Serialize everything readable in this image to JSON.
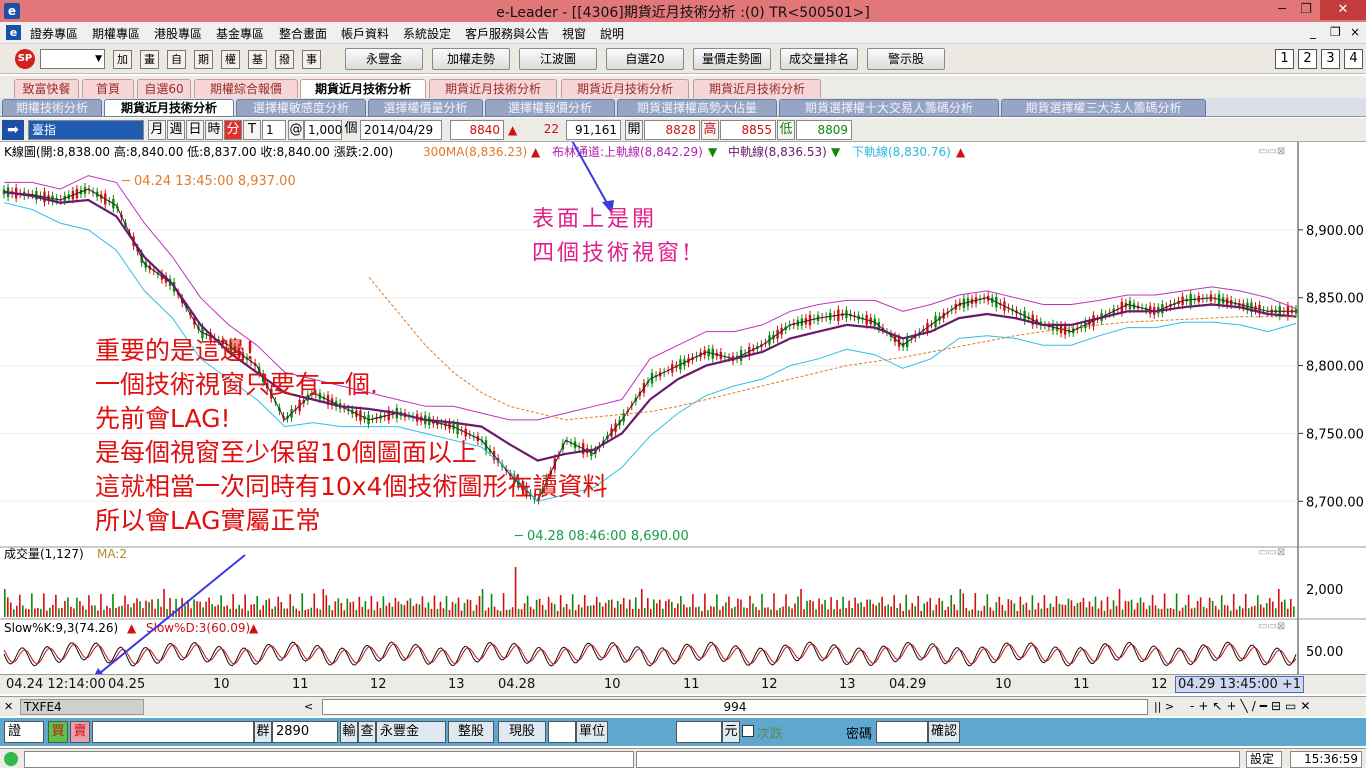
{
  "window": {
    "title": "e-Leader - [[4306]期貨近月技術分析 :(0) TR<500501>]",
    "icon": "e",
    "min": "─",
    "restore": "❐",
    "close": "✕"
  },
  "menu": {
    "icon": "e",
    "items": [
      "證券專區",
      "期權專區",
      "港股專區",
      "基金專區",
      "整合畫面",
      "帳戶資料",
      "系統設定",
      "客戶服務與公告",
      "視窗",
      "說明"
    ],
    "mdi": [
      "_",
      "❐",
      "×"
    ]
  },
  "toolbar": {
    "logo": "SP",
    "small_buttons": [
      "加",
      "畫",
      "自",
      "期",
      "權",
      "基",
      "撥",
      "事"
    ],
    "buttons": [
      "永豐金",
      "加權走勢",
      "江波圖",
      "自選20",
      "量價走勢圖",
      "成交量排名",
      "警示股"
    ],
    "nums": [
      "1",
      "2",
      "3",
      "4"
    ]
  },
  "tabs1": [
    "致富快餐",
    "首頁",
    "自選60",
    "期權綜合報價",
    "期貨近月技術分析",
    "期貨近月技術分析",
    "期貨近月技術分析",
    "期貨近月技術分析"
  ],
  "tabs2": [
    "期權技術分析",
    "期貨近月技術分析",
    "選擇權敏感度分析",
    "選擇權價量分析",
    "選擇權報價分析",
    "期貨選擇權高勢大佔量",
    "期貨選擇權十大交易人籌碼分析",
    "期貨選擇權三大法人籌碼分析"
  ],
  "charttb": {
    "symbol": "臺指",
    "period": [
      "月",
      "週",
      "日",
      "時",
      "分"
    ],
    "t": "T",
    "interval": "1",
    "at": "@",
    "count": "1,000",
    "unit": "個",
    "date": "2014/04/29",
    "price": "8840",
    "change": "22",
    "volume": "91,161",
    "open_label": "開",
    "open": "8828",
    "high_label": "高",
    "high": "8855",
    "low_label": "低",
    "low": "8809"
  },
  "chart": {
    "kline_info": "K線圖(開:8,838.00 高:8,840.00 低:8,837.00 收:8,840.00 漲跌:2.00)",
    "ma300": "300MA(8,836.23)",
    "boll_label": "布林通道:",
    "boll_upper": "上軌線(8,842.29)",
    "boll_mid": "中軌線(8,836.53)",
    "boll_lower": "下軌線(8,830.76)",
    "high_mark": "─ 04.24 13:45:00  8,937.00",
    "low_mark": "─ 04.28 08:46:00  8,690.00",
    "vol_label": "成交量(1,127)",
    "vol_ma": "MA:2",
    "kd_k": "Slow%K:9,3(74.26)",
    "kd_d": "Slow%D:3(60.09)"
  },
  "chart_data": {
    "type": "line",
    "ylim": [
      8670,
      8950
    ],
    "yticks": [
      "8,900.00",
      "8,850.00",
      "8,800.00",
      "8,750.00",
      "8,700.00"
    ],
    "vol_ticks": [
      "2,000"
    ],
    "kd_ticks": [
      "50.00"
    ],
    "xlabels": [
      "04.24 12:14:00",
      "04.25",
      "10",
      "11",
      "12",
      "13",
      "04.28",
      "10",
      "11",
      "12",
      "13",
      "04.29",
      "10",
      "11",
      "12",
      "04.29 13:45:00 +1"
    ],
    "series": [
      {
        "values": [
          8928,
          8926,
          8922,
          8930,
          8918,
          8875,
          8860,
          8825,
          8815,
          8800,
          8760,
          8780,
          8770,
          8760,
          8765,
          8760,
          8755,
          8745,
          8720,
          8700,
          8745,
          8735,
          8760,
          8790,
          8800,
          8810,
          8805,
          8815,
          8830,
          8835,
          8838,
          8832,
          8815,
          8830,
          8845,
          8850,
          8840,
          8830,
          8825,
          8835,
          8845,
          8840,
          8848,
          8850,
          8845,
          8840,
          8840
        ]
      },
      {
        "name": "上軌線",
        "values": [
          8935,
          8935,
          8930,
          8940,
          8935,
          8905,
          8880,
          8850,
          8830,
          8815,
          8795,
          8790,
          8785,
          8780,
          8775,
          8770,
          8770,
          8765,
          8760,
          8760,
          8765,
          8770,
          8775,
          8805,
          8815,
          8825,
          8825,
          8830,
          8840,
          8845,
          8848,
          8848,
          8840,
          8845,
          8852,
          8855,
          8850,
          8845,
          8845,
          8848,
          8852,
          8852,
          8855,
          8858,
          8855,
          8850,
          8842
        ]
      },
      {
        "name": "中軌線",
        "values": [
          8928,
          8925,
          8920,
          8922,
          8910,
          8880,
          8860,
          8830,
          8810,
          8795,
          8780,
          8775,
          8770,
          8768,
          8765,
          8760,
          8758,
          8755,
          8742,
          8730,
          8735,
          8738,
          8750,
          8775,
          8790,
          8800,
          8805,
          8810,
          8820,
          8825,
          8830,
          8828,
          8820,
          8825,
          8835,
          8838,
          8835,
          8830,
          8830,
          8835,
          8840,
          8840,
          8843,
          8845,
          8843,
          8838,
          8836
        ]
      },
      {
        "name": "下軌線",
        "values": [
          8920,
          8915,
          8905,
          8900,
          8885,
          8855,
          8835,
          8805,
          8790,
          8775,
          8755,
          8758,
          8755,
          8755,
          8755,
          8750,
          8745,
          8740,
          8722,
          8700,
          8705,
          8710,
          8725,
          8748,
          8765,
          8778,
          8785,
          8790,
          8800,
          8805,
          8812,
          8808,
          8798,
          8805,
          8820,
          8822,
          8820,
          8815,
          8815,
          8822,
          8828,
          8828,
          8832,
          8832,
          8830,
          8825,
          8831
        ]
      },
      {
        "name": "300MA",
        "values": [
          null,
          null,
          null,
          null,
          null,
          null,
          null,
          null,
          null,
          null,
          null,
          null,
          null,
          8865,
          8840,
          8815,
          8795,
          8780,
          8770,
          8765,
          8760,
          8762,
          8764,
          8766,
          8770,
          8775,
          8780,
          8785,
          8790,
          8795,
          8800,
          8803,
          8806,
          8810,
          8814,
          8818,
          8822,
          8825,
          8828,
          8830,
          8832,
          8833,
          8834,
          8835,
          8836,
          8836,
          8836
        ]
      }
    ]
  },
  "annotations": {
    "red": [
      "重要的是這邊!",
      "一個技術視窗只要有一個.",
      "先前會LAG!",
      "是每個視窗至少保留10個圖面以上",
      "這就相當一次同時有10x4個技術圖形在讀資料",
      "所以會LAG實屬正常"
    ],
    "pink": [
      "表面上是開",
      "四個技術視窗!"
    ],
    "arrow_color": "#3a3ae0",
    "circle_color": "#e04040"
  },
  "scroll": {
    "symbol": "TXFE4",
    "value": "994"
  },
  "order": {
    "side": "證",
    "buy": "買",
    "sell": "賣",
    "group_label": "群",
    "group": "2890",
    "input_label": "輸",
    "query": "查",
    "broker": "永豐金",
    "lot": "整股",
    "type": "現股",
    "unit_label": "單位",
    "yuan": "元",
    "ci_die": "次跌",
    "password": "密碼",
    "confirm": "確認"
  },
  "status": {
    "settings": "設定",
    "time": "15:36:59"
  }
}
